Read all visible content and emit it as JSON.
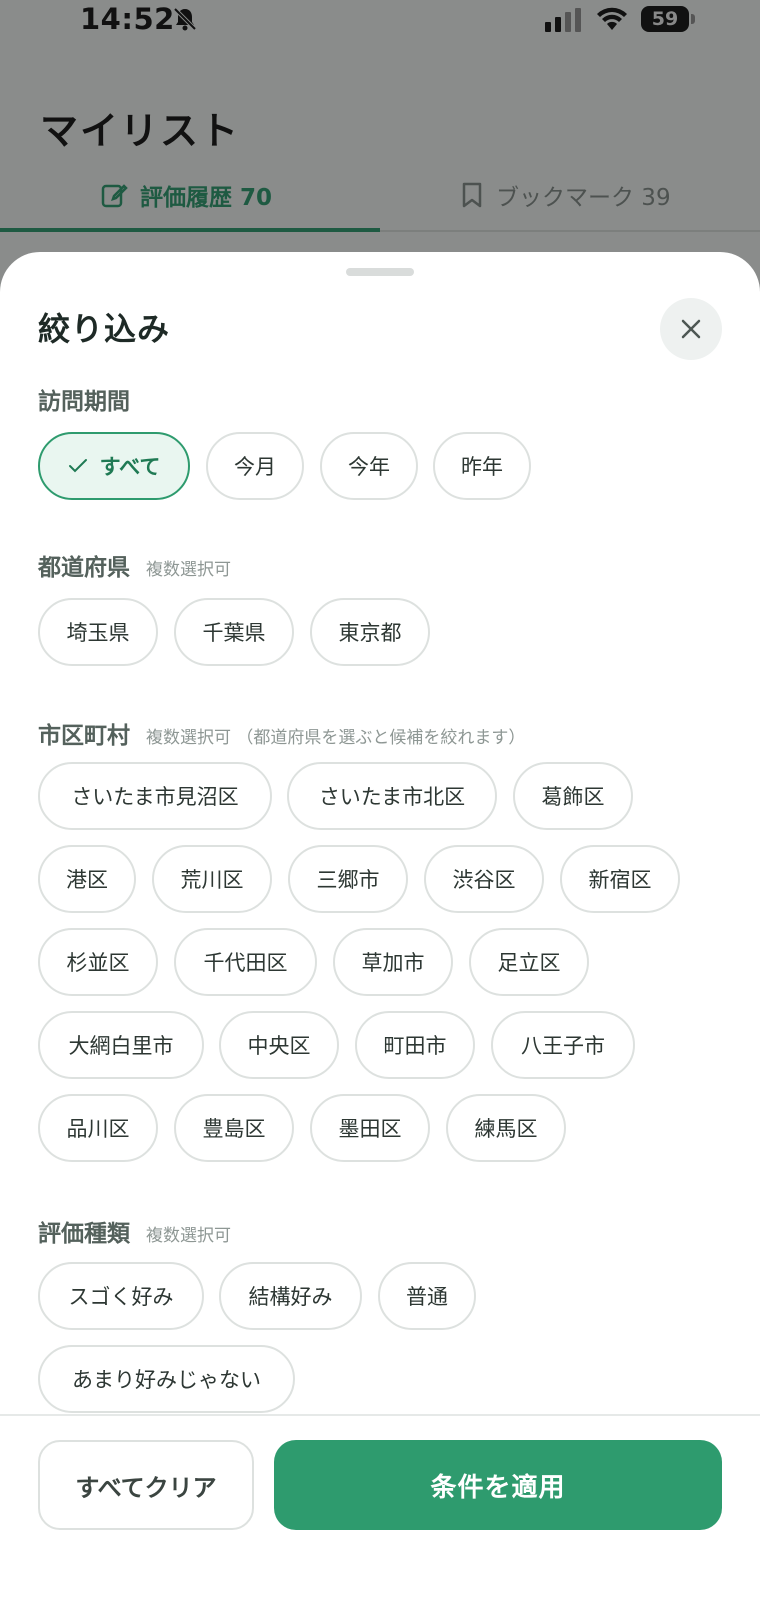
{
  "status_bar": {
    "time": "14:52",
    "battery": "59"
  },
  "background_page": {
    "title": "マイリスト",
    "tabs": [
      {
        "label": "評価履歴 70",
        "active": true
      },
      {
        "label": "ブックマーク 39",
        "active": false
      }
    ]
  },
  "sheet": {
    "title": "絞り込み",
    "sections": {
      "visit_period": {
        "label": "訪問期間",
        "chips": [
          "すべて",
          "今月",
          "今年",
          "昨年"
        ],
        "selected": "すべて"
      },
      "prefecture": {
        "label": "都道府県",
        "hint": "複数選択可",
        "chips": [
          "埼玉県",
          "千葉県",
          "東京都"
        ]
      },
      "city": {
        "label": "市区町村",
        "hint": "複数選択可 （都道府県を選ぶと候補を絞れます）",
        "chips": [
          "さいたま市見沼区",
          "さいたま市北区",
          "葛飾区",
          "港区",
          "荒川区",
          "三郷市",
          "渋谷区",
          "新宿区",
          "杉並区",
          "千代田区",
          "草加市",
          "足立区",
          "大網白里市",
          "中央区",
          "町田市",
          "八王子市",
          "品川区",
          "豊島区",
          "墨田区",
          "練馬区"
        ]
      },
      "rating": {
        "label": "評価種類",
        "hint": "複数選択可",
        "chips": [
          "スゴく好み",
          "結構好み",
          "普通",
          "あまり好みじゃない"
        ]
      }
    },
    "footer": {
      "clear_label": "すべてクリア",
      "apply_label": "条件を適用"
    }
  },
  "colors": {
    "accent": "#2e9b6e",
    "accent_dark": "#1e5a42",
    "chip_border": "#dde1df"
  }
}
